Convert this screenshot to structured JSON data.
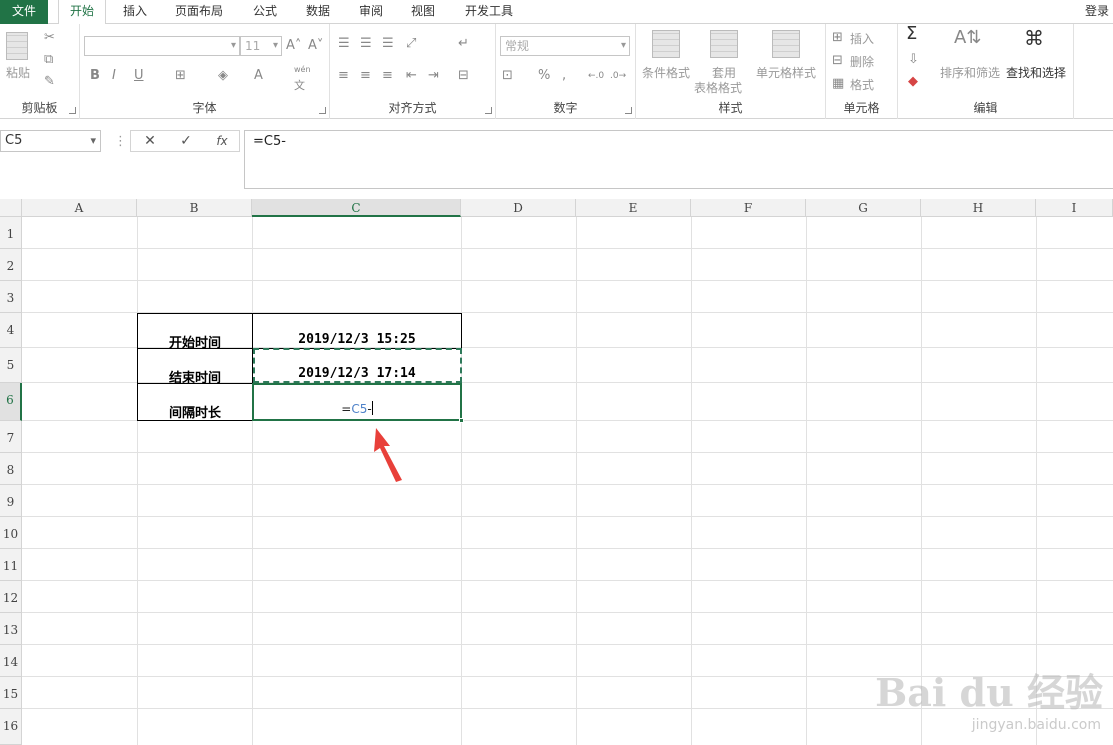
{
  "tabs": [
    {
      "label": "文件",
      "key": "file"
    },
    {
      "label": "开始",
      "key": "home"
    },
    {
      "label": "插入",
      "key": "insert"
    },
    {
      "label": "页面布局",
      "key": "layout"
    },
    {
      "label": "公式",
      "key": "formulas"
    },
    {
      "label": "数据",
      "key": "data"
    },
    {
      "label": "审阅",
      "key": "review"
    },
    {
      "label": "视图",
      "key": "view"
    },
    {
      "label": "开发工具",
      "key": "developer"
    }
  ],
  "login": "登录",
  "ribbon": {
    "clipboard": {
      "label": "剪贴板",
      "paste": "粘贴"
    },
    "font": {
      "label": "字体",
      "size": "11",
      "bold": "B",
      "italic": "I",
      "underline": "U",
      "phonetic_top": "wén",
      "phonetic_bottom": "文"
    },
    "alignment": {
      "label": "对齐方式"
    },
    "number": {
      "label": "数字",
      "format": "常规",
      "percent": "%",
      "comma": ","
    },
    "styles": {
      "label": "样式",
      "conditional": "条件格式",
      "table_line1": "套用",
      "table_line2": "表格格式",
      "cell_styles": "单元格样式"
    },
    "cells": {
      "label": "单元格",
      "insert": "插入",
      "delete": "删除",
      "format": "格式"
    },
    "editing": {
      "label": "编辑",
      "sort": "排序和筛选",
      "find": "查找和选择"
    }
  },
  "formula_bar": {
    "name_box": "C5",
    "cancel": "✕",
    "enter": "✓",
    "fx": "fx",
    "content": "=C5-"
  },
  "columns": [
    "A",
    "B",
    "C",
    "D",
    "E",
    "F",
    "G",
    "H",
    "I"
  ],
  "rows": [
    "1",
    "2",
    "3",
    "4",
    "5",
    "6",
    "7",
    "8",
    "9",
    "10",
    "11",
    "12",
    "13",
    "14",
    "15",
    "16"
  ],
  "table": {
    "start_label": "开始时间",
    "start_value": "2019/12/3 15:25",
    "end_label": "结束时间",
    "end_value": "2019/12/3 17:14",
    "interval_label": "间隔时长",
    "editing_prefix": "=",
    "editing_ref": "C5",
    "editing_suffix": "-"
  },
  "watermark": {
    "main": "Bai du 经验",
    "sub": "jingyan.baidu.com"
  },
  "colors": {
    "accent": "#217346",
    "arrow": "#e8403a",
    "ref": "#4f82c9"
  }
}
